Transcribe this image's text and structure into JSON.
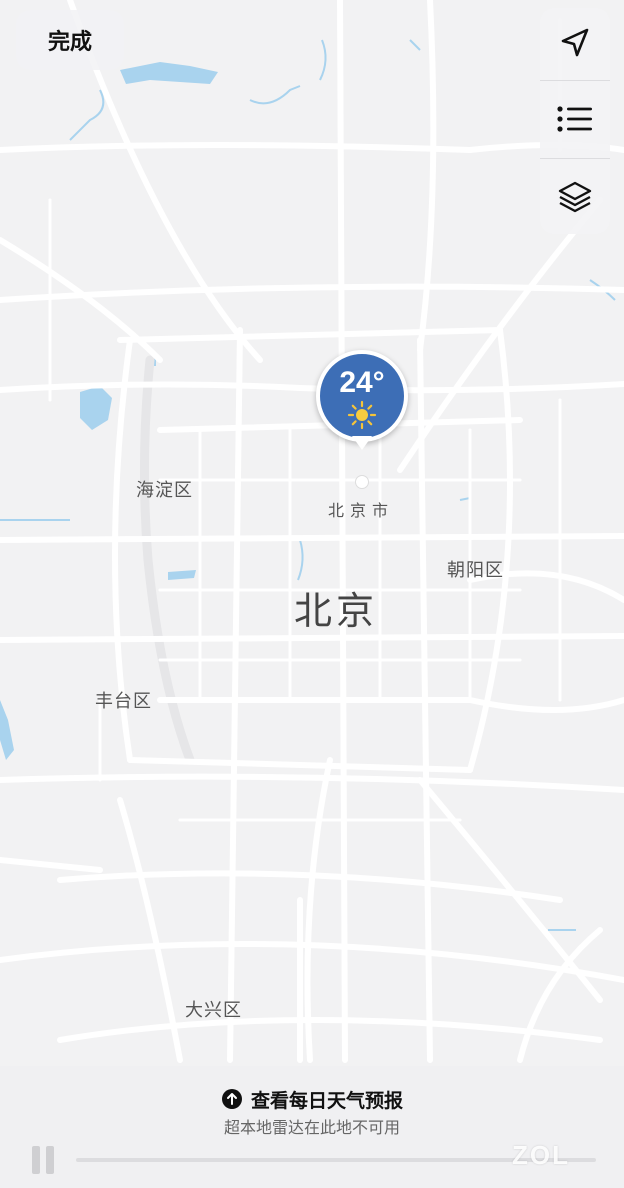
{
  "toolbar": {
    "done_label": "完成"
  },
  "controls": [
    {
      "name": "location-arrow-icon"
    },
    {
      "name": "list-icon"
    },
    {
      "name": "layers-icon"
    }
  ],
  "weather_pin": {
    "temperature": "24°",
    "condition_icon": "sun-icon"
  },
  "map": {
    "city_label": "北京",
    "city_marker_label": "北京市",
    "districts": {
      "haidian": "海淀区",
      "chaoyang": "朝阳区",
      "fengtai": "丰台区",
      "daxing": "大兴区"
    },
    "colors": {
      "background": "#f2f2f3",
      "road": "#ffffff",
      "water": "#a9d3ee",
      "pin": "#3d6eb6"
    }
  },
  "bottom": {
    "forecast_label": "查看每日天气预报",
    "radar_note": "超本地雷达在此地不可用"
  },
  "watermark": "ZOL"
}
